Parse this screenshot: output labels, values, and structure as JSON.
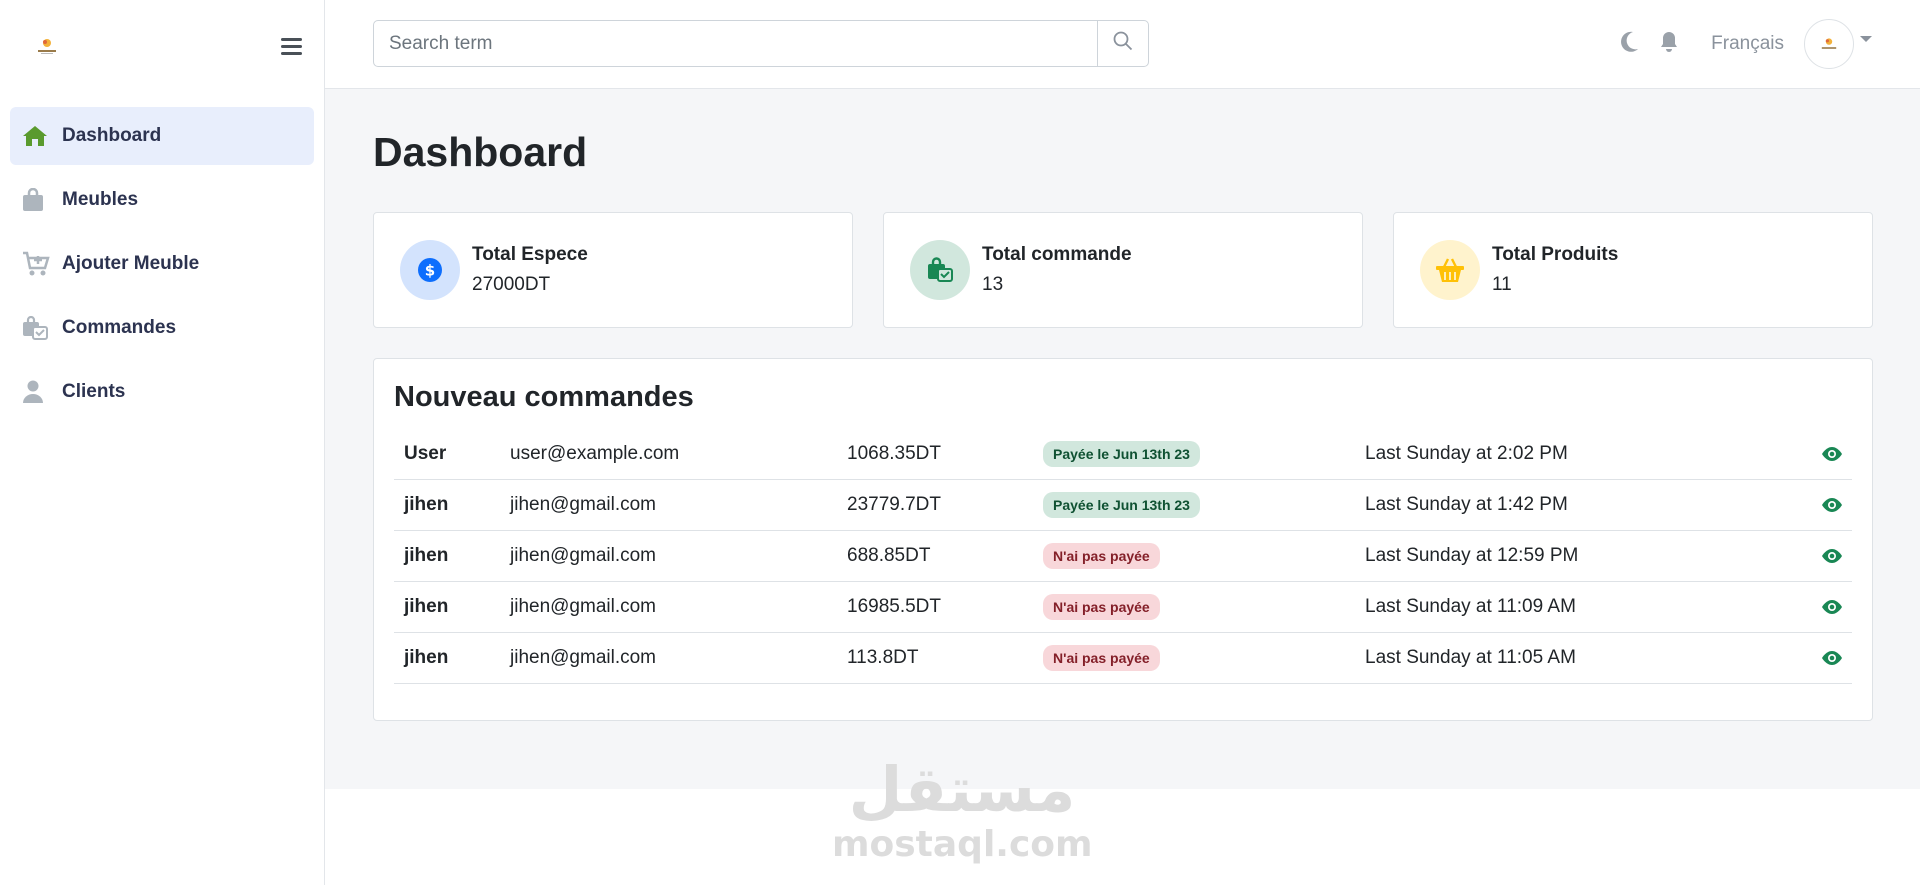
{
  "sidebar": {
    "items": [
      {
        "label": "Dashboard",
        "icon": "home-icon",
        "active": true
      },
      {
        "label": "Meubles",
        "icon": "shopping-bag-icon",
        "active": false
      },
      {
        "label": "Ajouter Meuble",
        "icon": "cart-plus-icon",
        "active": false
      },
      {
        "label": "Commandes",
        "icon": "bag-check-icon",
        "active": false
      },
      {
        "label": "Clients",
        "icon": "user-icon",
        "active": false
      }
    ]
  },
  "topbar": {
    "search_placeholder": "Search term",
    "language": "Français"
  },
  "main": {
    "title": "Dashboard",
    "cards": [
      {
        "title": "Total Espece",
        "value": "27000DT",
        "icon": "dollar-icon",
        "icon_bg": "#d3e3fd",
        "icon_color": "#0d6efd"
      },
      {
        "title": "Total commande",
        "value": "13",
        "icon": "bag-check-icon",
        "icon_bg": "#d1e7dd",
        "icon_color": "#198754"
      },
      {
        "title": "Total Produits",
        "value": "11",
        "icon": "basket-icon",
        "icon_bg": "#fff3cd",
        "icon_color": "#ffc107"
      }
    ],
    "orders": {
      "title": "Nouveau commandes",
      "rows": [
        {
          "user": "User",
          "email": "user@example.com",
          "amount": "1068.35DT",
          "status": "Payée le Jun 13th 23",
          "status_type": "paid",
          "date": "Last Sunday at 2:02 PM"
        },
        {
          "user": "jihen",
          "email": "jihen@gmail.com",
          "amount": "23779.7DT",
          "status": "Payée le Jun 13th 23",
          "status_type": "paid",
          "date": "Last Sunday at 1:42 PM"
        },
        {
          "user": "jihen",
          "email": "jihen@gmail.com",
          "amount": "688.85DT",
          "status": "N'ai pas payée",
          "status_type": "unpaid",
          "date": "Last Sunday at 12:59 PM"
        },
        {
          "user": "jihen",
          "email": "jihen@gmail.com",
          "amount": "16985.5DT",
          "status": "N'ai pas payée",
          "status_type": "unpaid",
          "date": "Last Sunday at 11:09 AM"
        },
        {
          "user": "jihen",
          "email": "jihen@gmail.com",
          "amount": "113.8DT",
          "status": "N'ai pas payée",
          "status_type": "unpaid",
          "date": "Last Sunday at 11:05 AM"
        }
      ]
    }
  },
  "watermark": {
    "arabic": "مستقل",
    "latin": "mostaql.com"
  },
  "colors": {
    "accent_green": "#198754",
    "active_bg": "#e8eefc",
    "nav_icon": "#adb5bd",
    "home_icon": "#5a9a2e"
  }
}
